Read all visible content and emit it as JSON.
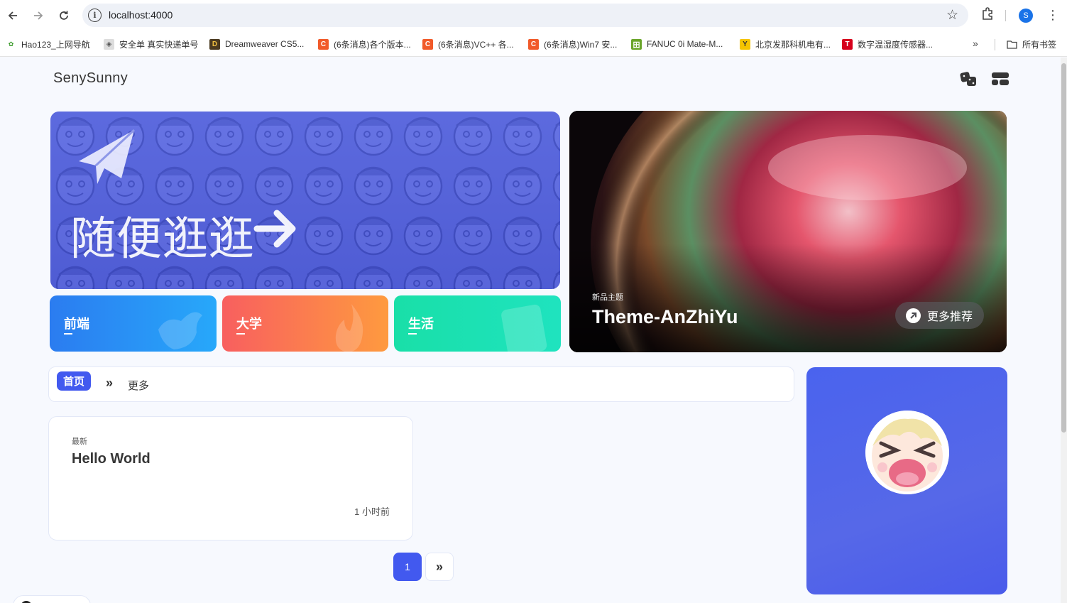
{
  "browser": {
    "url": "localhost:4000",
    "profile_initial": "S",
    "bookmarks": [
      {
        "label": "Hao123_上网导航",
        "icon": "hao123-icon"
      },
      {
        "label": "安全单 真实快递单号",
        "icon": "site-icon"
      },
      {
        "label": "Dreamweaver CS5...",
        "icon": "dreamweaver-icon"
      },
      {
        "label": "(6条消息)各个版本...",
        "icon": "csdn-icon"
      },
      {
        "label": "(6条消息)VC++ 各...",
        "icon": "csdn-icon"
      },
      {
        "label": "(6条消息)Win7 安...",
        "icon": "csdn-icon"
      },
      {
        "label": "FANUC 0i Mate-M...",
        "icon": "fanuc-icon"
      },
      {
        "label": "北京发那科机电有...",
        "icon": "fanuc-logo-icon"
      },
      {
        "label": "数字温湿度传感器...",
        "icon": "t-icon"
      }
    ],
    "bookmarks_folder": "所有书签"
  },
  "site": {
    "name": "SenySunny"
  },
  "hero": {
    "title": "随便逛逛",
    "color": "#5a67dd"
  },
  "categories": [
    {
      "label": "前端",
      "color_from": "#2b7cf0",
      "color_to": "#27a8fa"
    },
    {
      "label": "大学",
      "color_from": "#f85f5f",
      "color_to": "#fe9a3f"
    },
    {
      "label": "生活",
      "color_from": "#19dfa8",
      "color_to": "#1fe3bf"
    }
  ],
  "feature": {
    "subtitle": "新品主题",
    "title": "Theme-AnZhiYu",
    "button_label": "更多推荐"
  },
  "catbar": {
    "home_label": "首页",
    "more_label": "更多"
  },
  "post": {
    "tag": "最新",
    "title": "Hello World",
    "time": "1 小时前"
  },
  "pager": {
    "current_page": "1"
  },
  "colors": {
    "accent": "#4259ef"
  }
}
